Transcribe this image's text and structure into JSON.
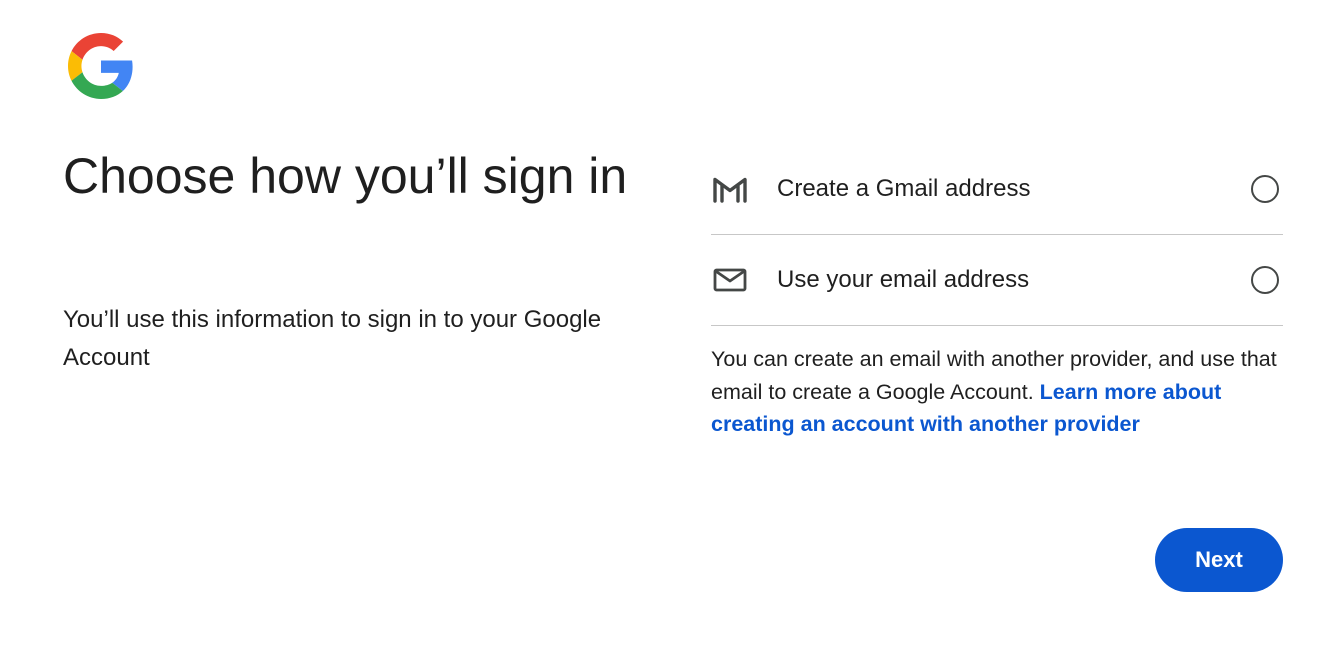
{
  "logo": {
    "icon": "google-g-logo"
  },
  "headline": "Choose how you’ll sign in",
  "subtext": "You’ll use this information to sign in to your Google Account",
  "options": [
    {
      "icon": "gmail-icon",
      "label": "Create a Gmail address",
      "selected": false
    },
    {
      "icon": "mail-icon",
      "label": "Use your email address",
      "selected": false
    }
  ],
  "help": {
    "text": "You can create an email with another provider, and use that email to create a Google Account. ",
    "link_text": "Learn more about creating an account with another provider"
  },
  "next_button": {
    "label": "Next"
  },
  "colors": {
    "accent": "#0b57d0",
    "text": "#1f1f1f",
    "divider": "#c7c7c7",
    "google_blue": "#4285F4",
    "google_red": "#EA4335",
    "google_yellow": "#FBBC05",
    "google_green": "#34A853"
  }
}
